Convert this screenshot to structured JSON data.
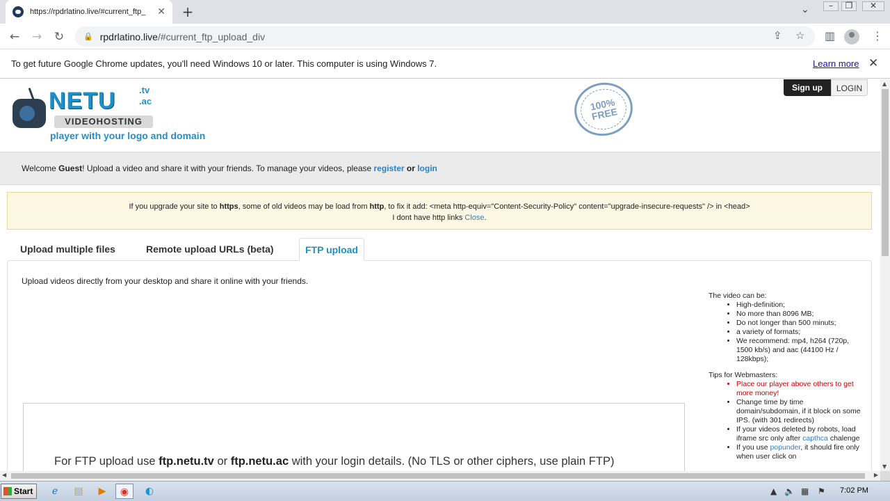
{
  "browser": {
    "tab_title": "https://rpdrlatino.live/#current_ftp_",
    "new_tab": "+",
    "url_host": "rpdrlatino.live",
    "url_path": "/#current_ftp_upload_div",
    "infobar_text": "To get future Google Chrome updates, you'll need Windows 10 or later. This computer is using Windows 7.",
    "infobar_link": "Learn more"
  },
  "site": {
    "logo_name": "NETU",
    "logo_tld1": ".tv",
    "logo_tld2": ".ac",
    "logo_sub": "VIDEOHOSTING",
    "tagline": "player with your logo and domain",
    "seal_text": "100% FREE",
    "signup": "Sign up",
    "login": "LOGIN"
  },
  "welcome": {
    "prefix": "Welcome ",
    "guest": "Guest",
    "middle": "! Upload a video and share it with your friends. To manage your videos, please ",
    "register": "register",
    "or": " or ",
    "login": "login"
  },
  "notice": {
    "l1a": "If you upgrade your site to ",
    "https": "https",
    "l1b": ", some of old videos may be load from ",
    "http": "http",
    "l1c": ", to fix it add: <meta http-equiv=\"Content-Security-Policy\" content=\"upgrade-insecure-requests\" /> in <head>",
    "l2": "I dont have http links ",
    "close": "Close",
    "period": "."
  },
  "tabs": [
    "Upload multiple files",
    "Remote upload URLs (beta)",
    "FTP upload"
  ],
  "panel": {
    "intro": "Upload videos directly from your desktop and share it online with your friends.",
    "video_can_be": "The video can be:",
    "video_items": [
      "High-definition;",
      "No more than 8096 MB;",
      "Do not longer than 500 minuts;",
      "a variety of formats;",
      "We recommend: mp4, h264 (720p, 1500 kb/s) and aac (44100 Hz / 128kbps);"
    ],
    "tips_title": "Tips for Webmasters:",
    "tip1": "Place our player above others to get more money!",
    "tip2": "Change time by time domain/subdomain, if it block on some IPS. (with 301 redirects)",
    "tip3a": "If your videos deleted by robots, load iframe src only after ",
    "tip3link": "capthca",
    "tip3b": " chalenge",
    "tip4a": "If you use ",
    "tip4link": "popunder",
    "tip4b": ", it should fire only when user click on",
    "ftp_a": "For FTP upload use ",
    "ftp_host1": "ftp.netu.tv",
    "ftp_or": " or ",
    "ftp_host2": "ftp.netu.ac",
    "ftp_b": " with your login details. (No TLS or other ciphers, use plain FTP)"
  },
  "taskbar": {
    "start": "Start",
    "clock": "7:02 PM"
  }
}
